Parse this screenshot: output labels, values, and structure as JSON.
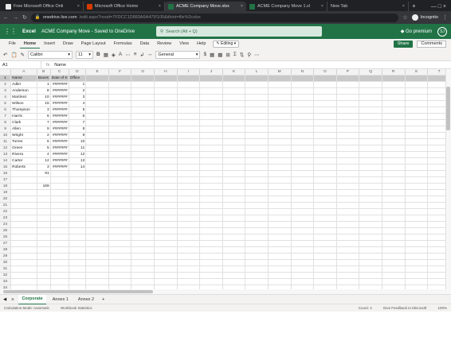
{
  "browser": {
    "tabs": [
      {
        "title": "Free Microsoft Office Onli",
        "fav": "ms"
      },
      {
        "title": "Microsoft Office Home",
        "fav": "off"
      },
      {
        "title": "ACME Company Move.xlsx",
        "fav": "xl",
        "active": true
      },
      {
        "title": "ACME Company Move 1.xl",
        "fav": "xl"
      },
      {
        "title": "New Tab",
        "fav": ""
      }
    ],
    "url_host": "onedrive.live.com",
    "url_path": "/edit.aspx?resid=7FDCC1D883A6A479!105&ithint=file%2cxlsx",
    "incognito_label": "Incognito"
  },
  "excel": {
    "app_name": "Excel",
    "doc_title": "ACME Company Move  -  Saved to OneDrive",
    "search_placeholder": "Search (Alt + Q)",
    "premium": "Go premium",
    "avatar": "SJ",
    "menus": [
      "File",
      "Home",
      "Insert",
      "Draw",
      "Page Layout",
      "Formulas",
      "Data",
      "Review",
      "View",
      "Help"
    ],
    "selected_menu": "Home",
    "editing": "Editing",
    "share": "Share",
    "comments": "Comments",
    "font": "Calibri",
    "font_size": "11",
    "number_format": "General",
    "name_box": "A1",
    "formula": "Name"
  },
  "grid": {
    "columns": [
      "A",
      "B",
      "C",
      "D",
      "E",
      "F",
      "G",
      "H",
      "I",
      "J",
      "K",
      "L",
      "M",
      "N",
      "O",
      "P",
      "Q",
      "R",
      "S",
      "T"
    ],
    "rows": [
      [
        "Name",
        "Boxes",
        "Date of K",
        "Office"
      ],
      [
        "Adler",
        "1",
        "#######",
        "1"
      ],
      [
        "Anderson",
        "8",
        "#######",
        "2"
      ],
      [
        "Martinez",
        "10",
        "#######",
        "3"
      ],
      [
        "Wilson",
        "15",
        "#######",
        "4"
      ],
      [
        "Thompson",
        "3",
        "#######",
        "5"
      ],
      [
        "Harris",
        "6",
        "#######",
        "6"
      ],
      [
        "Clark",
        "7",
        "#######",
        "7"
      ],
      [
        "Allen",
        "9",
        "#######",
        "8"
      ],
      [
        "Wright",
        "2",
        "#######",
        "9"
      ],
      [
        "Torres",
        "6",
        "#######",
        "10"
      ],
      [
        "Green",
        "5",
        "#######",
        "11"
      ],
      [
        "Rivera",
        "4",
        "#######",
        "12"
      ],
      [
        "Carter",
        "12",
        "#######",
        "13"
      ],
      [
        "Roberts",
        "3",
        "#######",
        "14"
      ],
      [
        "",
        "91",
        "",
        ""
      ],
      [
        "",
        "",
        "",
        ""
      ],
      [
        "",
        "169",
        "",
        ""
      ]
    ],
    "row_count": 34
  },
  "sheets": [
    "Corporate",
    "Annex 1",
    "Annex 2"
  ],
  "selected_sheet": "Corporate",
  "status": {
    "calc": "Calculation Mode: Automatic",
    "stats": "Workbook Statistics",
    "count": "Count: 4",
    "feedback": "Give Feedback to Microsoft",
    "zoom": "100%"
  }
}
